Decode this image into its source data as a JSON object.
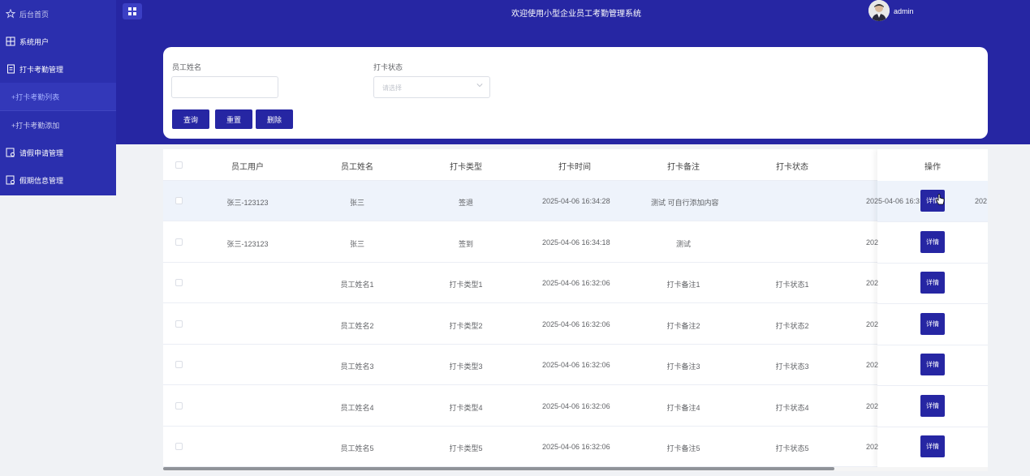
{
  "sidebar": {
    "items": [
      {
        "label": "后台首页",
        "icon": "star-icon"
      },
      {
        "label": "系统用户",
        "icon": "grid-icon"
      },
      {
        "label": "打卡考勤管理",
        "icon": "document-icon"
      },
      {
        "label": "请假申请管理",
        "icon": "form-icon"
      },
      {
        "label": "假期信息管理",
        "icon": "form-icon"
      }
    ],
    "subitems": [
      {
        "label": "+打卡考勤列表"
      },
      {
        "label": "+打卡考勤添加"
      }
    ]
  },
  "header": {
    "title": "欢迎使用小型企业员工考勤管理系统",
    "user": "admin"
  },
  "search": {
    "name_label": "员工姓名",
    "name_value": "",
    "status_label": "打卡状态",
    "status_placeholder": "请选择",
    "query_label": "查询",
    "reset_label": "重置",
    "delete_label": "删除"
  },
  "table": {
    "headers": [
      "员工用户",
      "员工姓名",
      "打卡类型",
      "打卡时间",
      "打卡备注",
      "打卡状态"
    ],
    "op_header": "操作",
    "detail_label": "详情",
    "rows": [
      {
        "user": "张三-123123",
        "name": "张三",
        "type": "签退",
        "time": "2025-04-06 16:34:28",
        "note": "测试 可自行添加内容",
        "status": "",
        "extra": "2025-04-06 16:3",
        "extra2": "202"
      },
      {
        "user": "张三-123123",
        "name": "张三",
        "type": "签到",
        "time": "2025-04-06 16:34:18",
        "note": "测试",
        "status": "",
        "extra": "202"
      },
      {
        "user": "",
        "name": "员工姓名1",
        "type": "打卡类型1",
        "time": "2025-04-06 16:32:06",
        "note": "打卡备注1",
        "status": "打卡状态1",
        "extra": "202"
      },
      {
        "user": "",
        "name": "员工姓名2",
        "type": "打卡类型2",
        "time": "2025-04-06 16:32:06",
        "note": "打卡备注2",
        "status": "打卡状态2",
        "extra": "202"
      },
      {
        "user": "",
        "name": "员工姓名3",
        "type": "打卡类型3",
        "time": "2025-04-06 16:32:06",
        "note": "打卡备注3",
        "status": "打卡状态3",
        "extra": "202"
      },
      {
        "user": "",
        "name": "员工姓名4",
        "type": "打卡类型4",
        "time": "2025-04-06 16:32:06",
        "note": "打卡备注4",
        "status": "打卡状态4",
        "extra": "202"
      },
      {
        "user": "",
        "name": "员工姓名5",
        "type": "打卡类型5",
        "time": "2025-04-06 16:32:06",
        "note": "打卡备注5",
        "status": "打卡状态5",
        "extra": "202"
      }
    ]
  },
  "colors": {
    "primary": "#2626a3",
    "sidebar": "#2b2fae",
    "active_sub": "#a5b1ff"
  }
}
